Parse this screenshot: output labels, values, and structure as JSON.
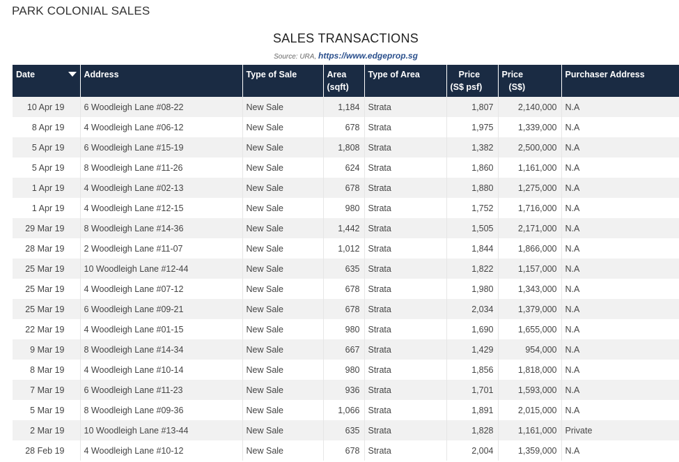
{
  "page": {
    "title": "PARK COLONIAL SALES",
    "table_title": "SALES TRANSACTIONS",
    "source_label": "Source: URA,",
    "source_link": "https://www.edgeprop.sg"
  },
  "columns": [
    {
      "l1": "Date",
      "l2": ""
    },
    {
      "l1": "Address",
      "l2": ""
    },
    {
      "l1": "Type of Sale",
      "l2": ""
    },
    {
      "l1": "Area",
      "l2": "(sqft)"
    },
    {
      "l1": "Type of Area",
      "l2": ""
    },
    {
      "l1": "Price",
      "l2": "(S$ psf)"
    },
    {
      "l1": "Price",
      "l2": "(S$)"
    },
    {
      "l1": "Purchaser Address",
      "l2": ""
    }
  ],
  "rows": [
    [
      "10 Apr 19",
      "6 Woodleigh Lane #08-22",
      "New Sale",
      "1,184",
      "Strata",
      "1,807",
      "2,140,000",
      "N.A"
    ],
    [
      "8 Apr 19",
      "4 Woodleigh Lane #06-12",
      "New Sale",
      "678",
      "Strata",
      "1,975",
      "1,339,000",
      "N.A"
    ],
    [
      "5 Apr 19",
      "6 Woodleigh Lane #15-19",
      "New Sale",
      "1,808",
      "Strata",
      "1,382",
      "2,500,000",
      "N.A"
    ],
    [
      "5 Apr 19",
      "8 Woodleigh Lane #11-26",
      "New Sale",
      "624",
      "Strata",
      "1,860",
      "1,161,000",
      "N.A"
    ],
    [
      "1 Apr 19",
      "4 Woodleigh Lane #02-13",
      "New Sale",
      "678",
      "Strata",
      "1,880",
      "1,275,000",
      "N.A"
    ],
    [
      "1 Apr 19",
      "4 Woodleigh Lane #12-15",
      "New Sale",
      "980",
      "Strata",
      "1,752",
      "1,716,000",
      "N.A"
    ],
    [
      "29 Mar 19",
      "8 Woodleigh Lane #14-36",
      "New Sale",
      "1,442",
      "Strata",
      "1,505",
      "2,171,000",
      "N.A"
    ],
    [
      "28 Mar 19",
      "2 Woodleigh Lane #11-07",
      "New Sale",
      "1,012",
      "Strata",
      "1,844",
      "1,866,000",
      "N.A"
    ],
    [
      "25 Mar 19",
      "10 Woodleigh Lane #12-44",
      "New Sale",
      "635",
      "Strata",
      "1,822",
      "1,157,000",
      "N.A"
    ],
    [
      "25 Mar 19",
      "4 Woodleigh Lane #07-12",
      "New Sale",
      "678",
      "Strata",
      "1,980",
      "1,343,000",
      "N.A"
    ],
    [
      "25 Mar 19",
      "6 Woodleigh Lane #09-21",
      "New Sale",
      "678",
      "Strata",
      "2,034",
      "1,379,000",
      "N.A"
    ],
    [
      "22 Mar 19",
      "4 Woodleigh Lane #01-15",
      "New Sale",
      "980",
      "Strata",
      "1,690",
      "1,655,000",
      "N.A"
    ],
    [
      "9 Mar 19",
      "8 Woodleigh Lane #14-34",
      "New Sale",
      "667",
      "Strata",
      "1,429",
      "954,000",
      "N.A"
    ],
    [
      "8 Mar 19",
      "4 Woodleigh Lane #10-14",
      "New Sale",
      "980",
      "Strata",
      "1,856",
      "1,818,000",
      "N.A"
    ],
    [
      "7 Mar 19",
      "6 Woodleigh Lane #11-23",
      "New Sale",
      "936",
      "Strata",
      "1,701",
      "1,593,000",
      "N.A"
    ],
    [
      "5 Mar 19",
      "8 Woodleigh Lane #09-36",
      "New Sale",
      "1,066",
      "Strata",
      "1,891",
      "2,015,000",
      "N.A"
    ],
    [
      "2 Mar 19",
      "10 Woodleigh Lane #13-44",
      "New Sale",
      "635",
      "Strata",
      "1,828",
      "1,161,000",
      "Private"
    ],
    [
      "28 Feb 19",
      "4 Woodleigh Lane #10-12",
      "New Sale",
      "678",
      "Strata",
      "2,004",
      "1,359,000",
      "N.A"
    ]
  ]
}
